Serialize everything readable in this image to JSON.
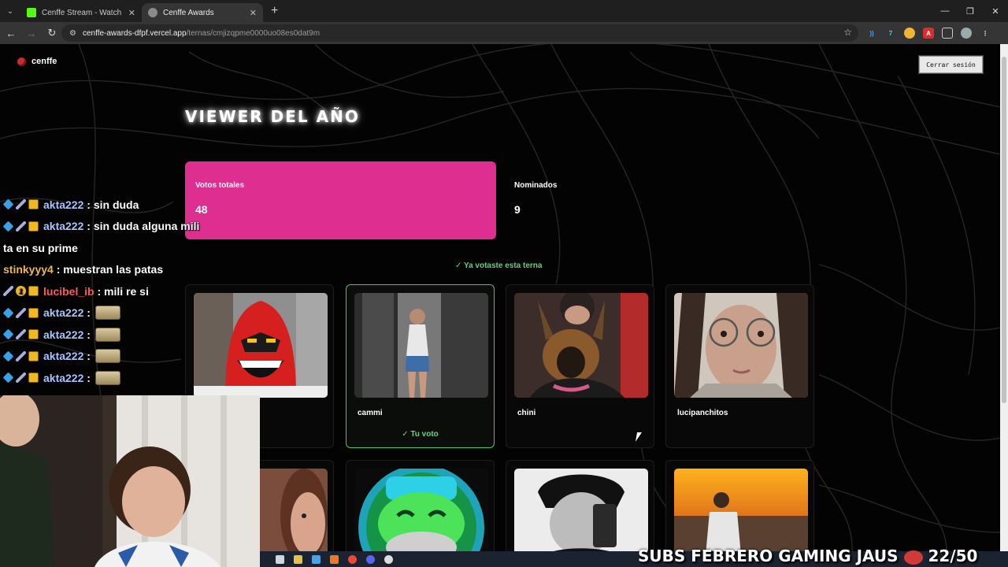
{
  "browser": {
    "tabs": [
      {
        "title": "Cenffe Stream - Watch Live on",
        "icon": "kick-icon",
        "color": "#53fc18"
      },
      {
        "title": "Cenffe Awards",
        "icon": "globe-icon",
        "color": "#8a8a8a"
      }
    ],
    "url_host": "cenffe-awards-dfpf.vercel.app",
    "url_path": "/ternas/cmjizqpme0000uo08es0dat9m"
  },
  "site": {
    "logo": "cenffe",
    "logout_label": "Cerrar sesión",
    "category_title": "VIEWER DEL AÑO",
    "stats": {
      "total_votes_label": "Votos totales",
      "total_votes_value": "48",
      "nominees_label": "Nominados",
      "nominees_value": "9"
    },
    "voted_notice": "✓ Ya votaste esta terna",
    "your_vote_label": "✓ Tu voto",
    "nominees": [
      {
        "name": "",
        "selected": false
      },
      {
        "name": "cammi",
        "selected": true
      },
      {
        "name": "chini",
        "selected": false
      },
      {
        "name": "lucipanchitos",
        "selected": false
      }
    ]
  },
  "chat": [
    {
      "user": "akta222",
      "msg": ": sin duda",
      "badges": [
        "cube",
        "sword",
        "crown"
      ],
      "color": "#a8c4ff"
    },
    {
      "user": "akta222",
      "msg": ": sin duda alguna mili",
      "badges": [
        "cube",
        "sword",
        "crown"
      ],
      "color": "#a8c4ff"
    },
    {
      "user": "",
      "msg": "ta en su prime",
      "badges": [],
      "color": "#fff"
    },
    {
      "user": "stinkyyy4",
      "msg": ": muestran las patas",
      "badges": [],
      "color": "#f0b84a"
    },
    {
      "user": "lucibel_ib",
      "msg": ": mili re si",
      "badges": [
        "sword",
        "one",
        "crown"
      ],
      "color": "#ff5b5b"
    },
    {
      "user": "akta222",
      "msg": ":",
      "badges": [
        "cube",
        "sword",
        "crown"
      ],
      "color": "#a8c4ff",
      "emote": true
    },
    {
      "user": "akta222",
      "msg": ":",
      "badges": [
        "cube",
        "sword",
        "crown"
      ],
      "color": "#a8c4ff",
      "emote": true
    },
    {
      "user": "akta222",
      "msg": ":",
      "badges": [
        "cube",
        "sword",
        "crown"
      ],
      "color": "#a8c4ff",
      "emote": true
    },
    {
      "user": "akta222",
      "msg": ":",
      "badges": [
        "cube",
        "sword",
        "crown"
      ],
      "color": "#a8c4ff",
      "emote": true
    }
  ],
  "overlay": {
    "subs_goal_label": "SUBS FEBRERO GAMING JAUS",
    "subs_count": "22/50"
  },
  "colors": {
    "accent_pink": "#de2e90",
    "vote_green": "#45c865"
  }
}
